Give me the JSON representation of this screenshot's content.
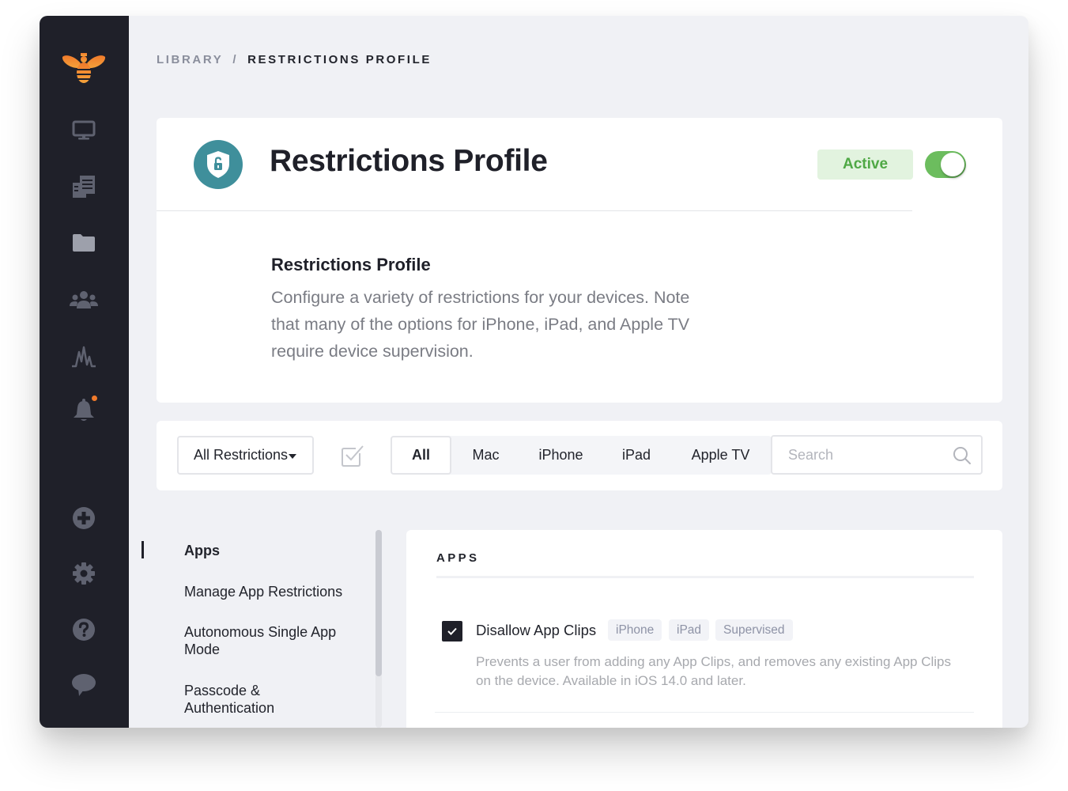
{
  "sidebar": {
    "logo": "bee-logo",
    "items": [
      {
        "name": "devices",
        "icon": "monitor-icon"
      },
      {
        "name": "library",
        "icon": "documents-icon"
      },
      {
        "name": "blueprints",
        "icon": "folder-icon"
      },
      {
        "name": "users",
        "icon": "users-icon"
      },
      {
        "name": "activity",
        "icon": "activity-icon"
      },
      {
        "name": "alerts",
        "icon": "bell-icon",
        "has_notification": true
      }
    ],
    "bottom_items": [
      {
        "name": "add",
        "icon": "plus-circle-icon"
      },
      {
        "name": "settings",
        "icon": "gear-icon"
      },
      {
        "name": "help",
        "icon": "question-circle-icon"
      },
      {
        "name": "chat",
        "icon": "chat-bubble-icon"
      }
    ]
  },
  "breadcrumb": {
    "parent": "LIBRARY",
    "separator": "/",
    "current": "RESTRICTIONS PROFILE"
  },
  "header": {
    "icon": "shield-lock-icon",
    "title": "Restrictions Profile",
    "status": "Active",
    "toggle_on": true,
    "description_title": "Restrictions Profile",
    "description": "Configure a variety of restrictions for your devices. Note that many of the options for iPhone, iPad, and Apple TV require device supervision."
  },
  "filters": {
    "dropdown_value": "All Restrictions",
    "segments": [
      "All",
      "Mac",
      "iPhone",
      "iPad",
      "Apple TV"
    ],
    "active_segment": "All",
    "search_placeholder": "Search"
  },
  "section_nav": {
    "items": [
      {
        "label": "Apps",
        "active": true
      },
      {
        "label": "Manage App Restrictions",
        "active": false
      },
      {
        "label": "Autonomous Single App Mode",
        "active": false
      },
      {
        "label": "Passcode & Authentication",
        "active": false
      }
    ]
  },
  "content": {
    "section_title": "APPS",
    "options": [
      {
        "label": "Disallow App Clips",
        "checked": true,
        "tags": [
          "iPhone",
          "iPad",
          "Supervised"
        ],
        "description": "Prevents a user from adding any App Clips, and removes any existing App Clips on the device. Available in iOS 14.0 and later."
      }
    ]
  },
  "colors": {
    "sidebar_bg": "#1f2029",
    "accent_orange": "#f0922b",
    "teal": "#3f8f9b",
    "active_green": "#6cbd5e",
    "active_badge_bg": "#e2f3df",
    "active_badge_text": "#4fa845"
  }
}
